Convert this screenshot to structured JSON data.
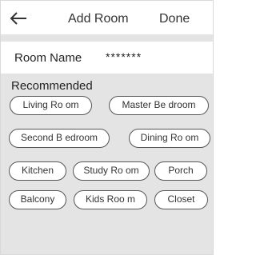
{
  "header": {
    "back_icon": "arrow-left-icon",
    "title": "Add Room",
    "done_label": "Done"
  },
  "room_name": {
    "label": "Room Name",
    "value": "*******"
  },
  "recommended": {
    "title": "Recommended",
    "rooms": [
      "Living Ro om",
      "Master Be droom",
      "Second B edroom",
      "Dining Ro om",
      "Kitchen",
      "Study Ro om",
      "Porch",
      "Balcony",
      "Kids Roo m",
      "Closet"
    ]
  }
}
